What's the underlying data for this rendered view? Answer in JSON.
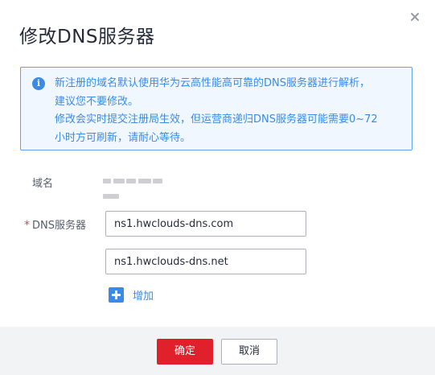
{
  "dialog": {
    "title": "修改DNS服务器",
    "close_icon": "close-icon"
  },
  "notice": {
    "icon": "info-icon",
    "icon_glyph": "i",
    "lines": [
      "新注册的域名默认使用华为云高性能高可靠的DNS服务器进行解析，",
      "建议您不要修改。",
      "修改会实时提交注册局生效，但运营商递归DNS服务器可能需要0~72",
      "小时方可刷新，请耐心等待。"
    ]
  },
  "form": {
    "domain_label": "域名",
    "dns_required_mark": "*",
    "dns_label": "DNS服务器",
    "dns_servers": [
      "ns1.hwclouds-dns.com",
      "ns1.hwclouds-dns.net"
    ],
    "add_icon": "plus-icon",
    "add_label": "增加"
  },
  "footer": {
    "ok_label": "确定",
    "cancel_label": "取消"
  },
  "colors": {
    "accent": "#3b8be6",
    "primary_button": "#e0202a",
    "required": "#e54545"
  }
}
